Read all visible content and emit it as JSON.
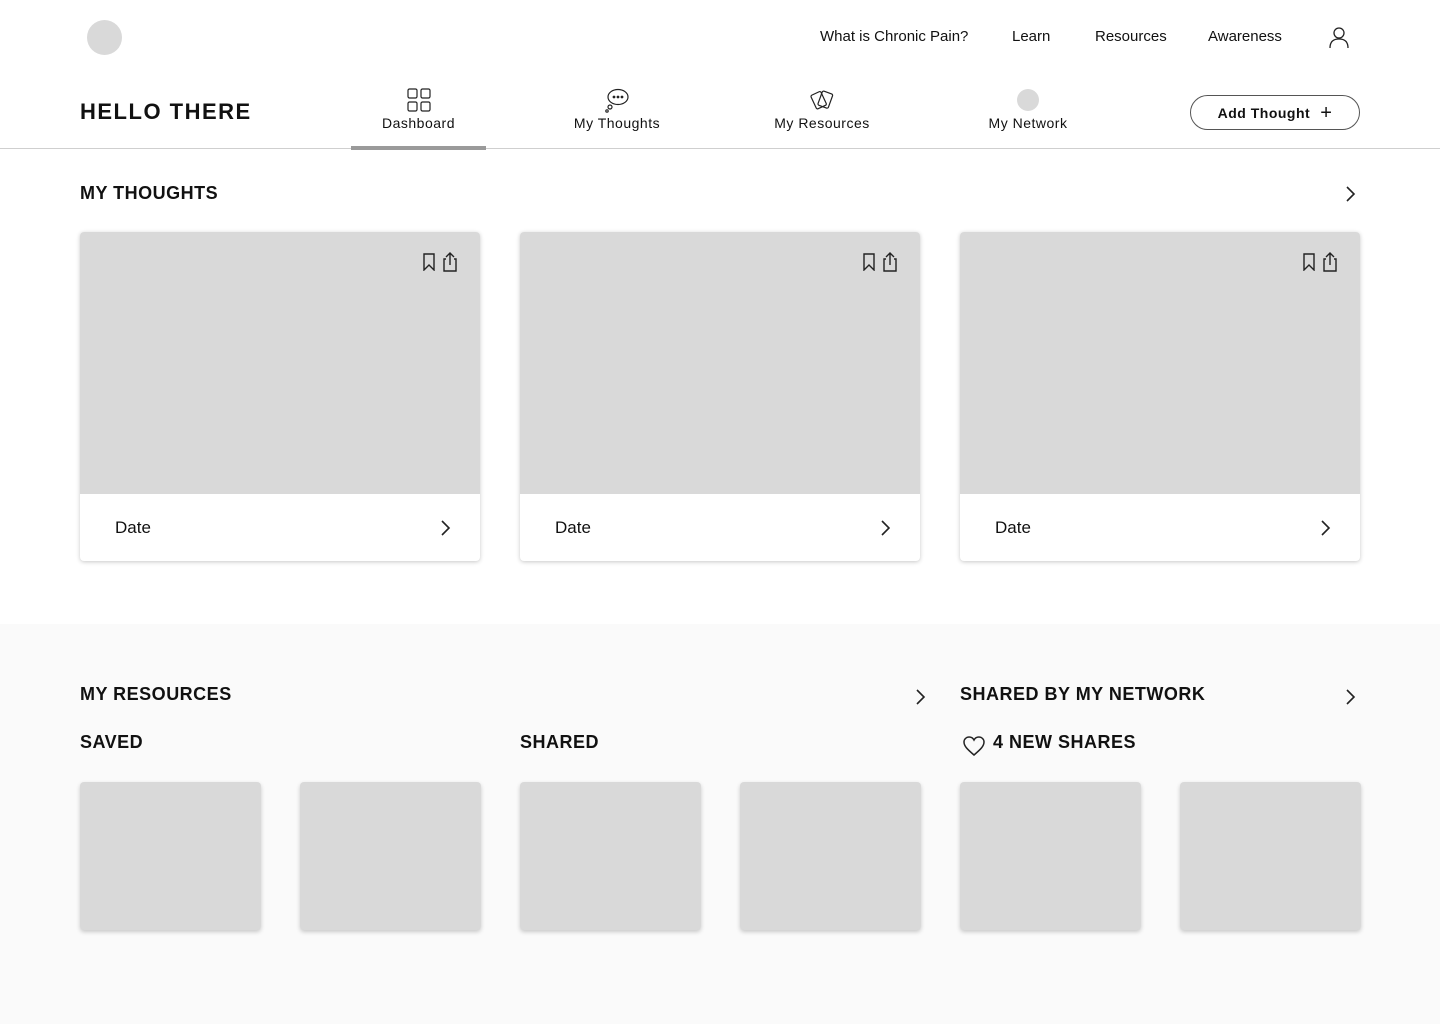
{
  "topnav": {
    "links": [
      "What is Chronic Pain?",
      "Learn",
      "Resources",
      "Awareness"
    ]
  },
  "subheader": {
    "greeting": "HELLO THERE",
    "tabs": [
      {
        "label": "Dashboard",
        "icon": "grid-icon",
        "active": true
      },
      {
        "label": "My Thoughts",
        "icon": "thought-bubble-icon",
        "active": false
      },
      {
        "label": "My Resources",
        "icon": "cards-icon",
        "active": false
      },
      {
        "label": "My Network",
        "icon": "network-avatar-icon",
        "active": false
      }
    ],
    "add_button_label": "Add Thought"
  },
  "thoughts": {
    "title": "MY THOUGHTS",
    "cards": [
      {
        "date": "Date"
      },
      {
        "date": "Date"
      },
      {
        "date": "Date"
      }
    ]
  },
  "resources": {
    "title": "MY RESOURCES",
    "saved_title": "SAVED",
    "shared_title": "SHARED"
  },
  "network": {
    "title": "SHARED BY MY NETWORK",
    "new_shares": "4 NEW SHARES"
  },
  "colors": {
    "placeholder": "#d9d9d9",
    "band": "#fafafa",
    "tab_indicator": "#9a9a9a"
  }
}
